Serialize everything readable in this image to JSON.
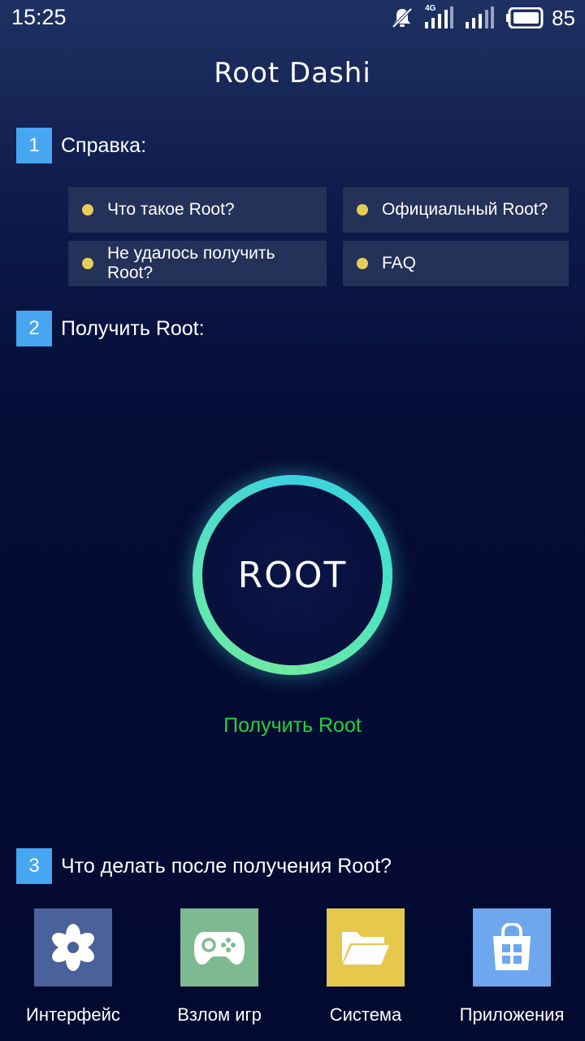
{
  "status_bar": {
    "time": "15:25",
    "network_type": "4G",
    "battery_level": "85",
    "icons": [
      "mute-icon",
      "signal-icon",
      "signal-icon",
      "battery-icon"
    ]
  },
  "app": {
    "title": "Root Dashi"
  },
  "sections": [
    {
      "number": "1",
      "label": "Справка:"
    },
    {
      "number": "2",
      "label": "Получить Root:"
    },
    {
      "number": "3",
      "label": "Что делать после получения Root?"
    }
  ],
  "help_items": [
    {
      "label": "Что такое Root?"
    },
    {
      "label": "Официальный Root?"
    },
    {
      "label": "Не удалось получить Root?"
    },
    {
      "label": "FAQ"
    }
  ],
  "root_button": {
    "label": "ROOT",
    "link_label": "Получить Root"
  },
  "tools": [
    {
      "label": "Интерфейс",
      "icon": "flower-icon",
      "color": "#4a6199"
    },
    {
      "label": "Взлом игр",
      "icon": "gamepad-icon",
      "color": "#7dba91"
    },
    {
      "label": "Система",
      "icon": "folder-icon",
      "color": "#e6c84c"
    },
    {
      "label": "Приложения",
      "icon": "store-bag-icon",
      "color": "#6fa7ee"
    }
  ],
  "colors": {
    "accent_blue": "#46a6f2",
    "help_dot": "#e6cd5a",
    "link_green": "#22d33a",
    "ring_cyan": "#3cd0e0",
    "ring_green": "#6fe8a0"
  }
}
